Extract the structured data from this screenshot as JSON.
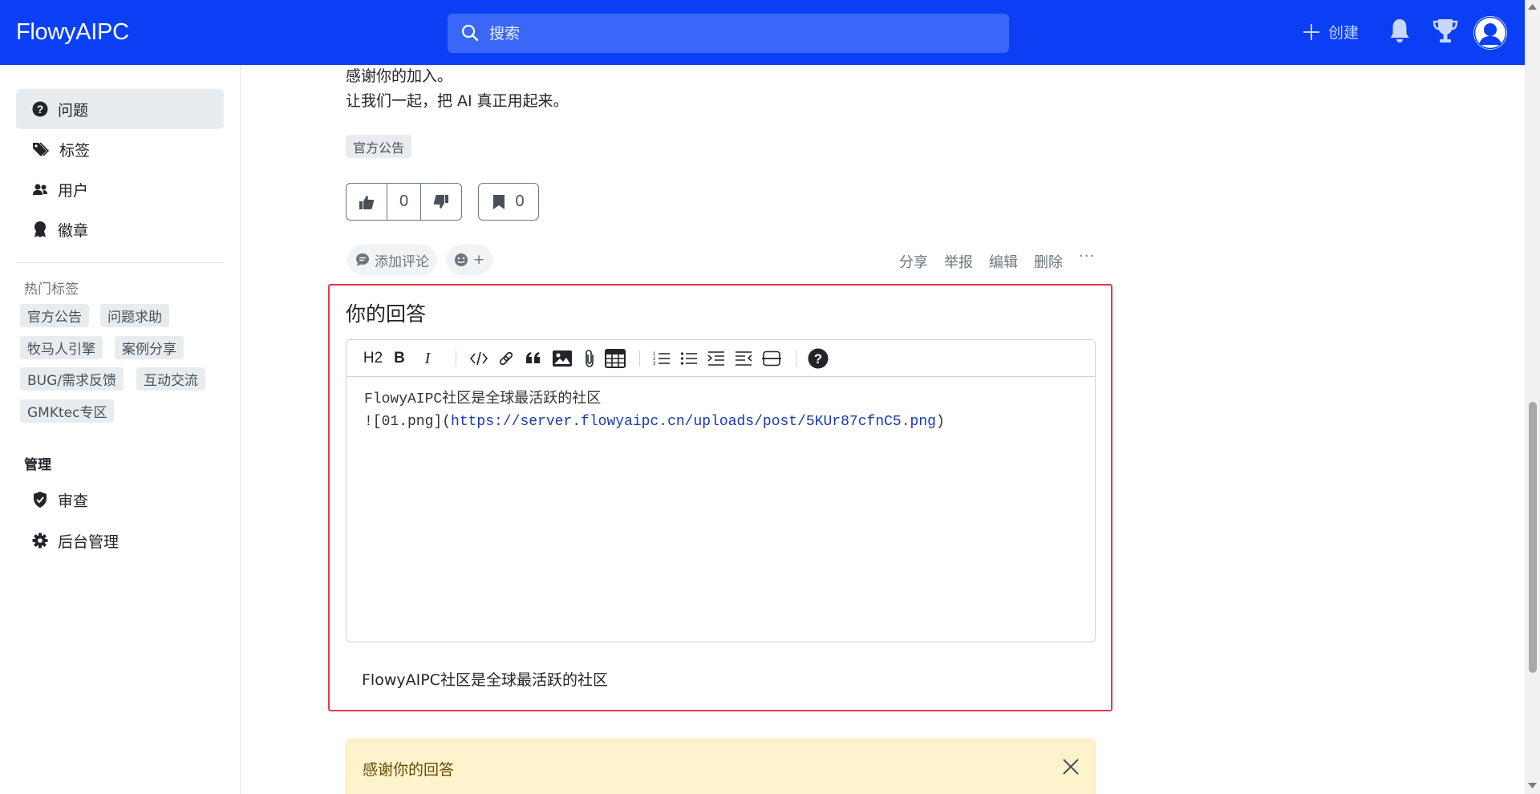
{
  "header": {
    "brand": "FlowyAIPC",
    "search_placeholder": "搜索",
    "create_label": "创建",
    "icons": [
      "search-icon",
      "plus-icon",
      "bell-icon",
      "trophy-icon",
      "avatar"
    ],
    "colors": {
      "bar": "#0a3ff5",
      "search_bg": "#3a67f7"
    }
  },
  "sidebar": {
    "nav": [
      {
        "label": "问题",
        "icon": "question-circle-icon",
        "active": true
      },
      {
        "label": "标签",
        "icon": "tags-icon",
        "active": false
      },
      {
        "label": "用户",
        "icon": "people-icon",
        "active": false
      },
      {
        "label": "徽章",
        "icon": "award-icon",
        "active": false
      }
    ],
    "hot_tags_title": "热门标签",
    "hot_tags": [
      "官方公告",
      "问题求助",
      "牧马人引擎",
      "案例分享",
      "BUG/需求反馈",
      "互动交流",
      "GMKtec专区"
    ],
    "admin_title": "管理",
    "admin_nav": [
      {
        "label": "审查",
        "icon": "shield-check-icon"
      },
      {
        "label": "后台管理",
        "icon": "gear-icon"
      }
    ]
  },
  "post": {
    "lines": [
      "感谢你的加入。",
      "让我们一起，把 AI 真正用起来。"
    ],
    "tag": "官方公告",
    "vote_count": "0",
    "bookmark_count": "0",
    "add_comment": "添加评论",
    "emoji_plus": "+",
    "actions": [
      "分享",
      "举报",
      "编辑",
      "删除"
    ],
    "more": "···"
  },
  "answer": {
    "title": "你的回答",
    "toolbar": {
      "heading": "H2",
      "bold": "B",
      "italic": "I",
      "icons": [
        "code-icon",
        "link-icon",
        "quote-icon",
        "image-icon",
        "attachment-icon",
        "table-icon",
        "ordered-list-icon",
        "unordered-list-icon",
        "indent-icon",
        "outdent-icon",
        "horizontal-rule-icon",
        "help-icon"
      ]
    },
    "editor_line1": "FlowyAIPC社区是全球最活跃的社区",
    "editor_line2_prefix": "![01.png](",
    "editor_line2_url": "https://server.flowyaipc.cn/uploads/post/5KUr87cfnC5.png",
    "editor_line2_suffix": ")",
    "preview": "FlowyAIPC社区是全球最活跃的社区",
    "highlight_color": "#e63946"
  },
  "alert": {
    "text": "感谢你的回答",
    "close_icon": "close-icon"
  }
}
